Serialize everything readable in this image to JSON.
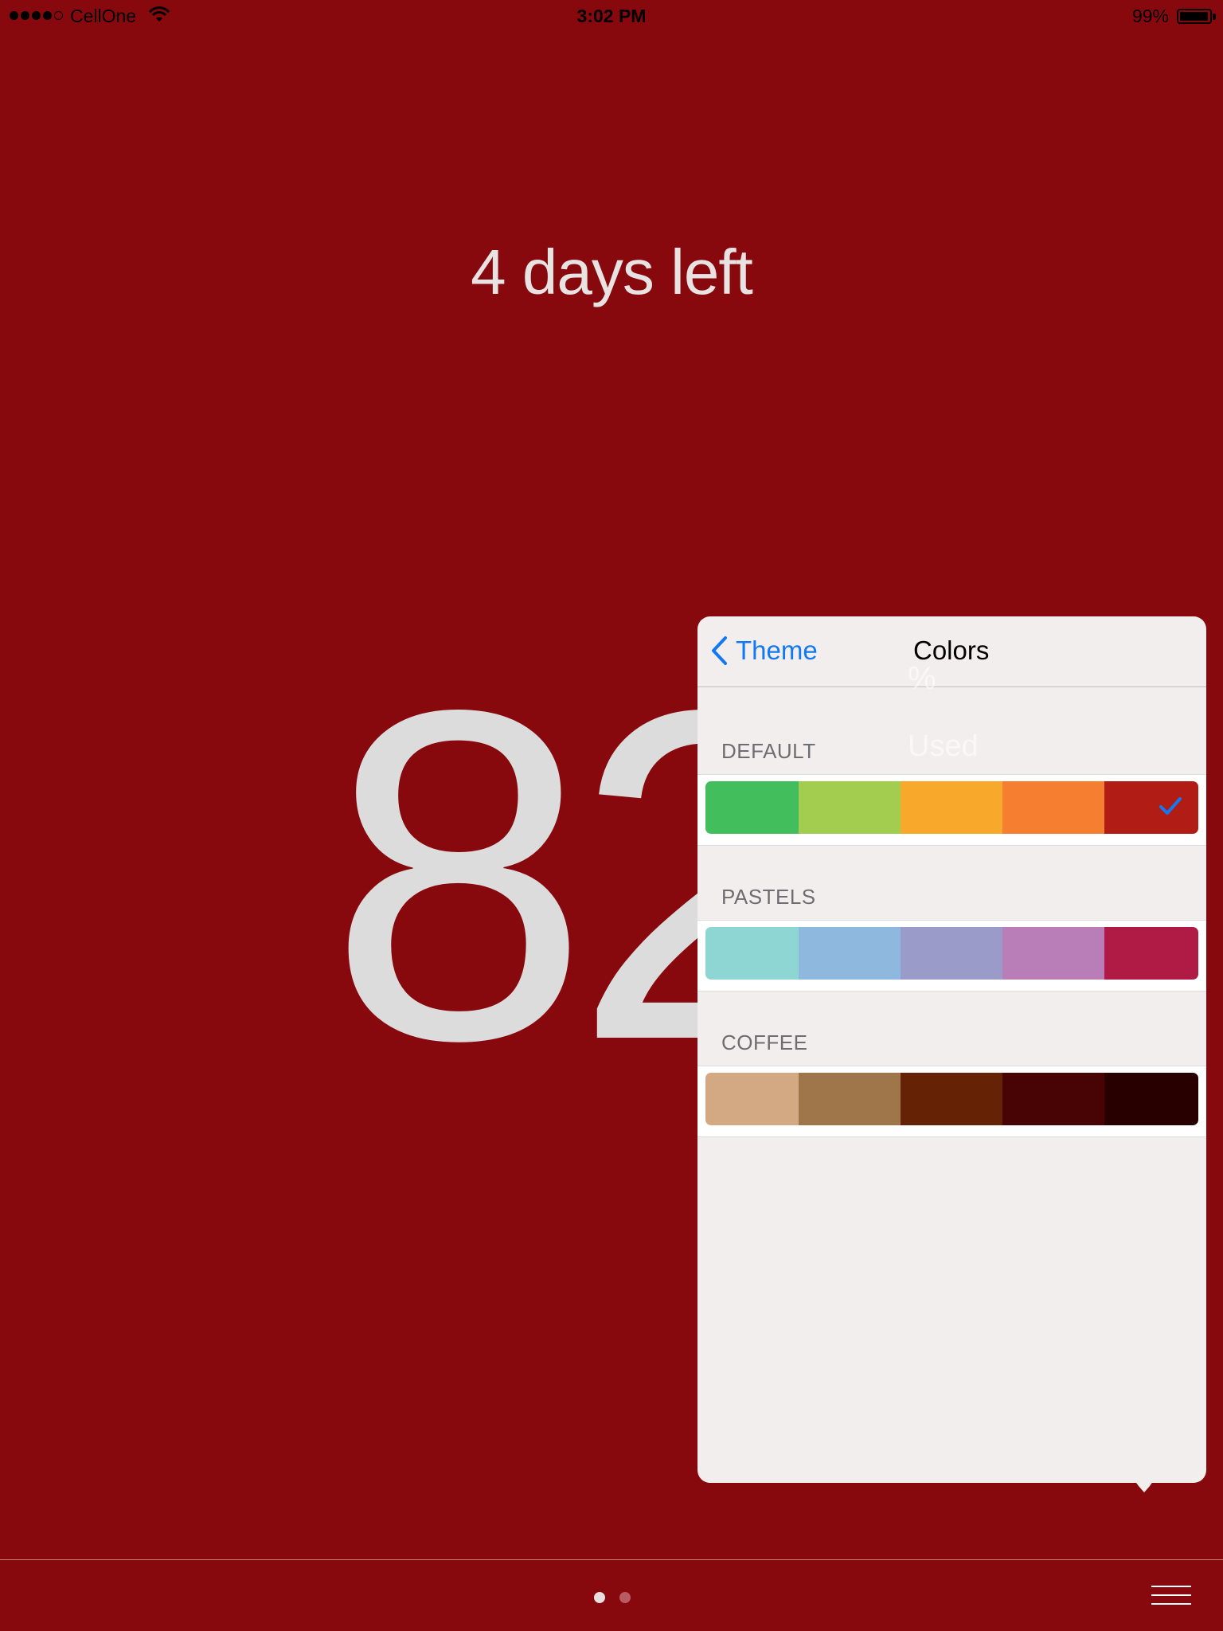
{
  "status_bar": {
    "carrier": "CellOne",
    "time": "3:02 PM",
    "battery": "99%"
  },
  "main": {
    "days_left": "4 days left",
    "usage_number": "82",
    "ghost_percent": "%",
    "ghost_used": "Used"
  },
  "popover": {
    "back_label": "Theme",
    "title": "Colors",
    "sections": [
      {
        "label": "DEFAULT",
        "colors": [
          "#43be5c",
          "#a2cd4f",
          "#f8a82b",
          "#f57e30",
          "#b11c15"
        ],
        "selected": true
      },
      {
        "label": "PASTELS",
        "colors": [
          "#8dd6d3",
          "#8fb8df",
          "#9b9bc9",
          "#b97db7",
          "#b01b45"
        ],
        "selected": false
      },
      {
        "label": "COFFEE",
        "colors": [
          "#d2a982",
          "#9e764a",
          "#662204",
          "#480404",
          "#290000"
        ],
        "selected": false
      }
    ]
  },
  "page_control": {
    "pages": 2,
    "current": 1
  },
  "colors": {
    "background": "#87090e",
    "accent": "#1179f2"
  }
}
